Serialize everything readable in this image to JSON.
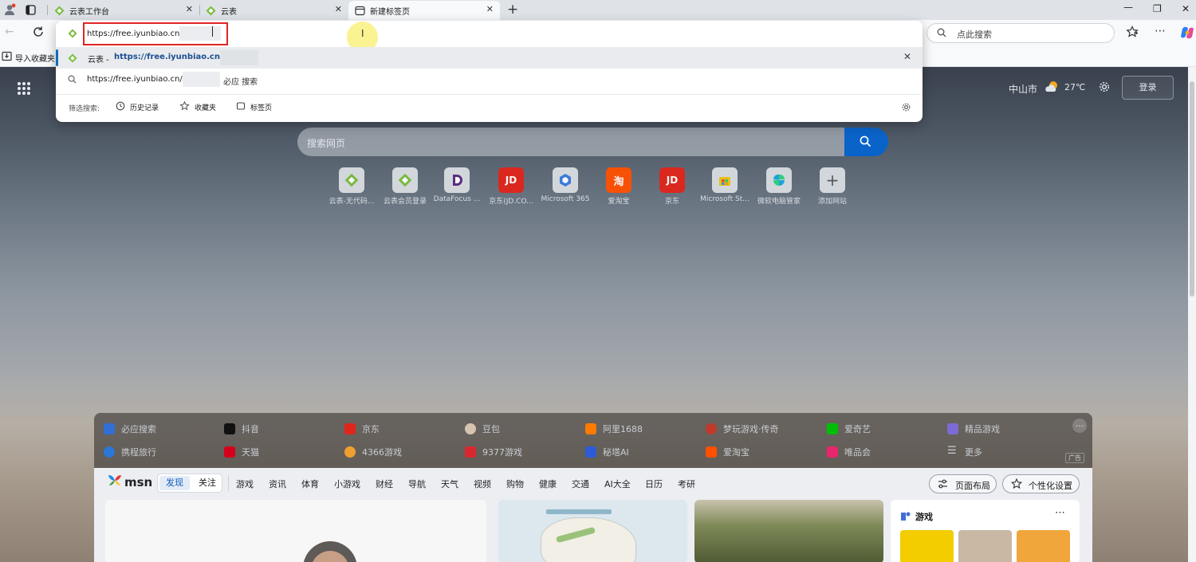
{
  "colors": {
    "accent": "#0f6cbd",
    "highlight_box": "#e02424",
    "search_button": "#0a63c9"
  },
  "tabs": [
    {
      "label": "云表工作台",
      "icon": "yunbiao-logo-icon"
    },
    {
      "label": "云表",
      "icon": "yunbiao-logo-icon"
    },
    {
      "label": "新建标签页",
      "icon": "new-tab-icon",
      "active": true
    }
  ],
  "address_bar": {
    "value": "https://free.iyunbiao.cn/"
  },
  "toolbar": {
    "search_placeholder": "点此搜索"
  },
  "favorites": {
    "import_label": "导入收藏夹"
  },
  "suggestions": {
    "top": {
      "prefix": "云表 - ",
      "url": "https://free.iyunbiao.cn/1"
    },
    "search": {
      "url": "https://free.iyunbiao.cn/",
      "suffix": "必应 搜索"
    },
    "filter_label": "筛选搜索:",
    "filters": [
      "历史记录",
      "收藏夹",
      "标签页"
    ]
  },
  "ntp": {
    "city": "中山市",
    "temperature": "27℃",
    "login": "登录",
    "search_placeholder": "搜索网页",
    "quick_links": [
      {
        "label": "云表-无代码...",
        "icon": "yunbiao-logo-icon"
      },
      {
        "label": "云表会员登录",
        "icon": "yunbiao-logo-icon"
      },
      {
        "label": "DataFocus ...",
        "icon": "datafocus-icon"
      },
      {
        "label": "京东(JD.CO...",
        "icon": "jd-icon"
      },
      {
        "label": "Microsoft 365",
        "icon": "microsoft365-icon"
      },
      {
        "label": "爱淘宝",
        "icon": "taobao-icon"
      },
      {
        "label": "京东",
        "icon": "jd-icon"
      },
      {
        "label": "Microsoft St...",
        "icon": "microsoft-store-icon"
      },
      {
        "label": "微软电脑管家",
        "icon": "pc-manager-icon"
      },
      {
        "label": "添加网站",
        "icon": "plus-icon"
      }
    ],
    "quick_bar_row1": [
      "必应搜索",
      "抖音",
      "京东",
      "豆包",
      "阿里1688",
      "梦玩游戏·传奇",
      "爱奇艺",
      "精品游戏"
    ],
    "quick_bar_row2": [
      "携程旅行",
      "天猫",
      "4366游戏",
      "9377游戏",
      "秘塔AI",
      "爱淘宝",
      "唯品会",
      "更多"
    ],
    "ad_label": "广告",
    "msn": {
      "logo": "msn",
      "tabs": [
        "发现",
        "关注"
      ],
      "categories": [
        "游戏",
        "资讯",
        "体育",
        "小游戏",
        "财经",
        "导航",
        "天气",
        "视频",
        "购物",
        "健康",
        "交通",
        "AI大全",
        "日历",
        "考研"
      ],
      "layout_button": "页面布局",
      "personalize_button": "个性化设置",
      "games_title": "游戏"
    }
  }
}
